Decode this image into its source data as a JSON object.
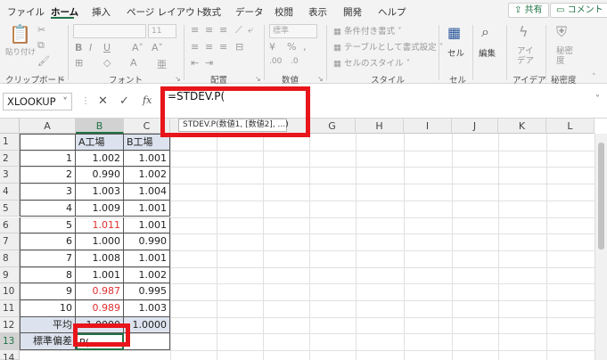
{
  "tabs": [
    "ファイル",
    "ホーム",
    "挿入",
    "ページ レイアウト",
    "数式",
    "データ",
    "校閲",
    "表示",
    "開発",
    "ヘルプ"
  ],
  "share_label": "共有",
  "comment_label": "コメント",
  "ribbon": {
    "groups": [
      "クリップボード",
      "フォント",
      "配置",
      "数値",
      "スタイル",
      "セル",
      "編集",
      "アイデア",
      "秘密度"
    ],
    "paste_label": "貼り付け",
    "font_size": "11",
    "number_format": "標準",
    "conditional_format": "条件付き書式",
    "format_as_table": "テーブルとして書式設定",
    "cell_styles": "セルのスタイル",
    "cells_label": "セル",
    "editing_label": "編集",
    "ideas_label": "アイ デア",
    "sensitivity_label": "秘密 度"
  },
  "formula_bar": {
    "name_box": "XLOOKUP",
    "cancel": "✕",
    "enter": "✓",
    "fx": "fx",
    "formula": "=STDEV.P(",
    "tooltip": "STDEV.P(数値1, [数値2], ...)"
  },
  "columns": [
    "A",
    "B",
    "C",
    "D",
    "E",
    "F",
    "G",
    "H",
    "I",
    "J",
    "K",
    "L"
  ],
  "rows": [
    "1",
    "2",
    "3",
    "4",
    "5",
    "6",
    "7",
    "8",
    "9",
    "10",
    "11",
    "12",
    "13",
    "14"
  ],
  "table": {
    "header_b": "A工場",
    "header_c": "B工場",
    "data": [
      {
        "a": "1",
        "b": "1.002",
        "c": "1.001",
        "b_red": false
      },
      {
        "a": "2",
        "b": "0.990",
        "c": "1.002",
        "b_red": false
      },
      {
        "a": "3",
        "b": "1.003",
        "c": "1.004",
        "b_red": false
      },
      {
        "a": "4",
        "b": "1.009",
        "c": "1.001",
        "b_red": false
      },
      {
        "a": "5",
        "b": "1.011",
        "c": "1.001",
        "b_red": true
      },
      {
        "a": "6",
        "b": "1.000",
        "c": "0.990",
        "b_red": false
      },
      {
        "a": "7",
        "b": "1.008",
        "c": "1.001",
        "b_red": false
      },
      {
        "a": "8",
        "b": "1.001",
        "c": "1.002",
        "b_red": false
      },
      {
        "a": "9",
        "b": "0.987",
        "c": "0.995",
        "b_red": true
      },
      {
        "a": "10",
        "b": "0.989",
        "c": "1.003",
        "b_red": true
      }
    ],
    "avg_label": "平均",
    "avg_b": "1.0000",
    "avg_c": "1.0000",
    "std_label": "標準偏差",
    "std_b_entry": "P("
  },
  "colors": {
    "accent": "#217346",
    "highlight": "#e8151b",
    "red_value": "#e03030"
  }
}
